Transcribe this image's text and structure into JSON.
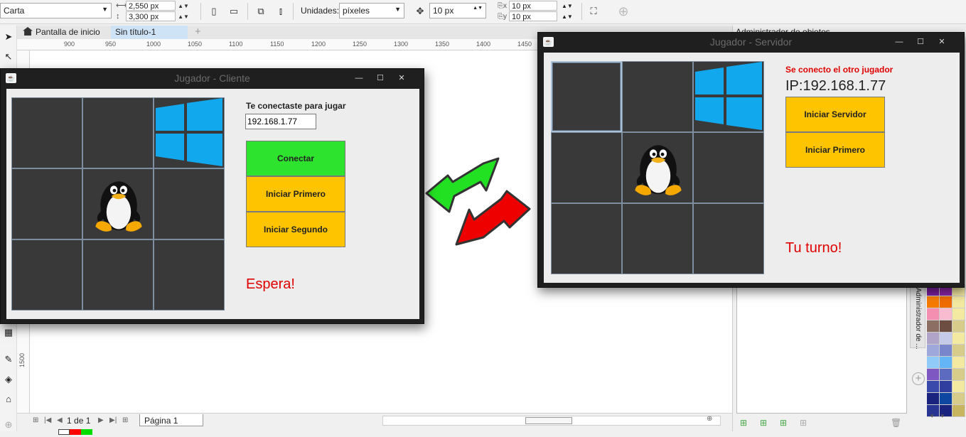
{
  "corel": {
    "font_combo": "Carta",
    "width_value": "2,550 px",
    "height_value": "3,300 px",
    "units_label": "Unidades:",
    "units_value": "píxeles",
    "nudge_value": "10 px",
    "dup_x": "10 px",
    "dup_y": "10 px",
    "tabs": {
      "home": "Pantalla de inicio",
      "doc": "Sin título-1",
      "add": "+"
    },
    "ruler_marks": [
      "900",
      "950",
      "1000",
      "1050",
      "1100",
      "1150",
      "1200",
      "1250",
      "1300",
      "1350",
      "1400",
      "1450"
    ],
    "ruler_v_mark": "1500",
    "page_current": "1",
    "page_of": "de",
    "page_total": "1",
    "page_tab": "Página 1",
    "docker_title": "Administrador de objetos",
    "vtab_label": "Administrador de ..."
  },
  "client": {
    "title": "Jugador - Cliente",
    "status_label": "Te conectaste para jugar",
    "ip_input_value": "192.168.1.77",
    "buttons": {
      "connect": "Conectar",
      "start_first": "Iniciar Primero",
      "start_second": "Iniciar Segundo"
    },
    "turn_message": "Espera!",
    "board": [
      "",
      "",
      "windows",
      "",
      "linux",
      "",
      "",
      "",
      ""
    ]
  },
  "server": {
    "title": "Jugador - Servidor",
    "status_label": "Se conecto el otro jugador",
    "ip_label": "IP:192.168.1.77",
    "buttons": {
      "start_server": "Iniciar Servidor",
      "start_first": "Iniciar Primero"
    },
    "turn_message": "Tu turno!",
    "board": [
      "",
      "",
      "windows",
      "",
      "linux",
      "",
      "",
      "",
      ""
    ],
    "selected_cell": 0
  },
  "colors": {
    "connect_green": "#2ee32e",
    "button_yellow": "#ffc400",
    "message_red": "#e00000",
    "board_dark": "#393939",
    "arrow_green": "#22e022",
    "arrow_red": "#ee0000"
  }
}
